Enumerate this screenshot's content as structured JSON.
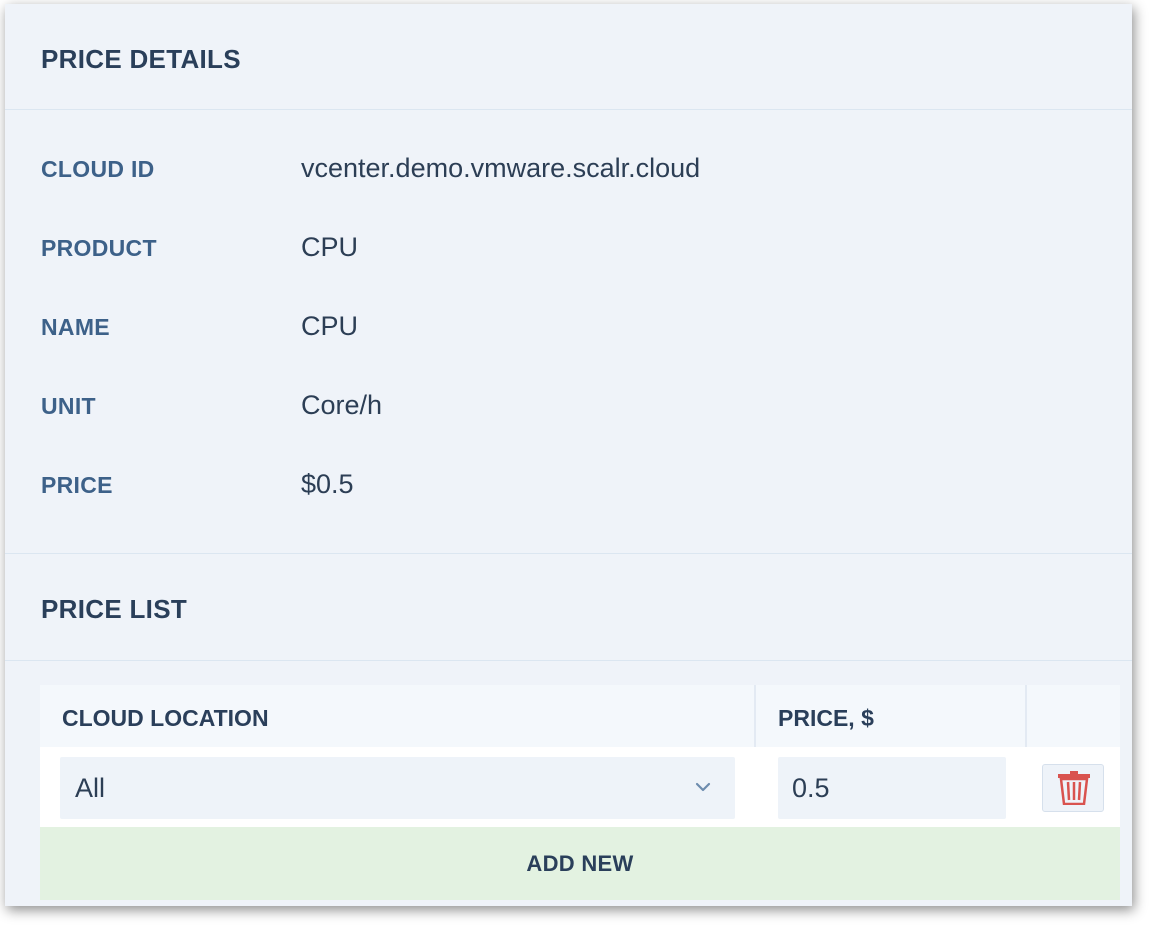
{
  "price_details": {
    "title": "PRICE DETAILS",
    "fields": [
      {
        "label": "CLOUD ID",
        "value": "vcenter.demo.vmware.scalr.cloud"
      },
      {
        "label": "PRODUCT",
        "value": "CPU"
      },
      {
        "label": "NAME",
        "value": "CPU"
      },
      {
        "label": "UNIT",
        "value": "Core/h"
      },
      {
        "label": "PRICE",
        "value": "$0.5"
      }
    ]
  },
  "price_list": {
    "title": "PRICE LIST",
    "columns": {
      "location": "CLOUD LOCATION",
      "price": "PRICE, $"
    },
    "rows": [
      {
        "location": "All",
        "price": "0.5"
      }
    ],
    "add_new_label": "ADD NEW"
  },
  "icons": {
    "dropdown": "chevron-down-icon",
    "delete": "trash-icon"
  },
  "colors": {
    "panel_bg": "#eff3f9",
    "label": "#3d6189",
    "title": "#2a3f5a",
    "delete": "#d9534f",
    "add_new_bg": "#e3f2e1"
  }
}
